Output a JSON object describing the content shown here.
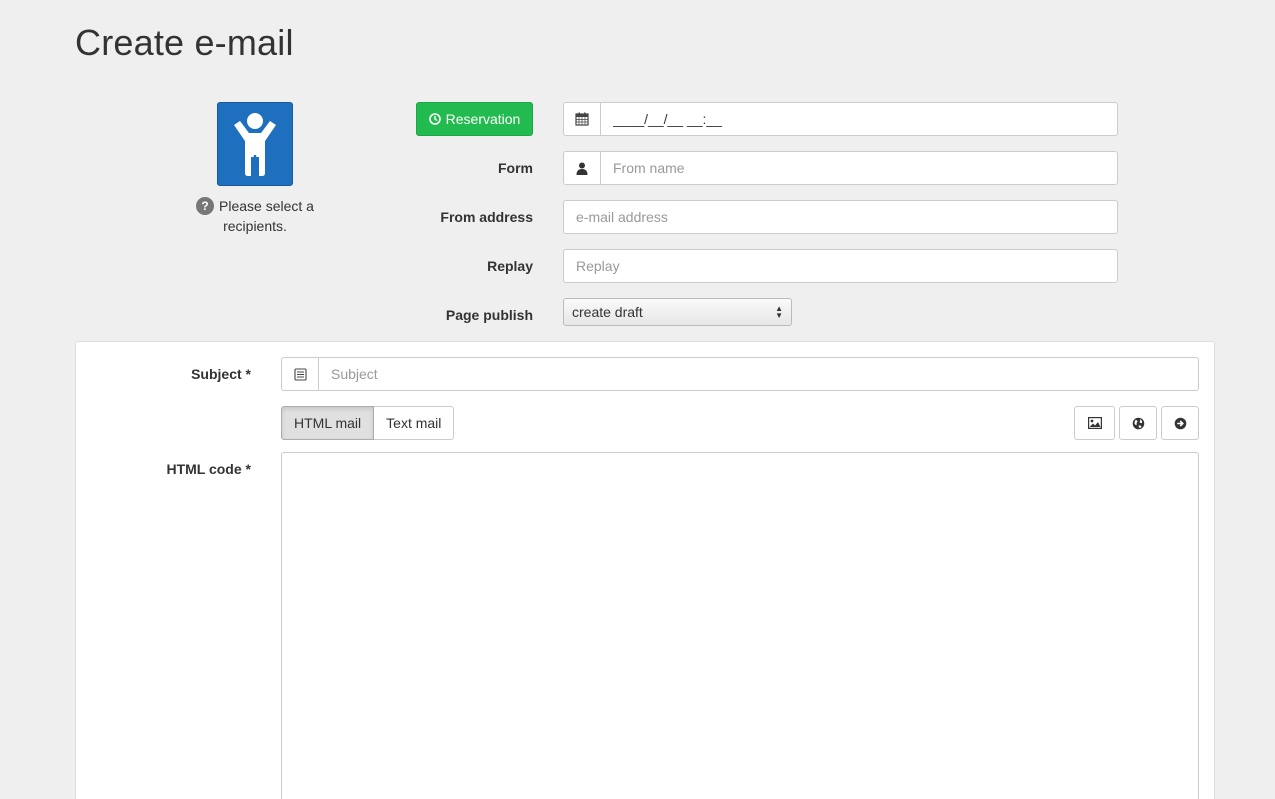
{
  "page": {
    "title": "Create e-mail"
  },
  "recipient": {
    "icon": "person-icon",
    "help_badge": "?",
    "help_text": "Please select a recipients."
  },
  "form": {
    "reservation_button": "Reservation",
    "datetime_value": "____/__/__ __:__",
    "from_label": "Form",
    "from_placeholder": "From name",
    "from_address_label": "From address",
    "from_address_placeholder": "e-mail address",
    "reply_label": "Replay",
    "reply_placeholder": "Replay",
    "publish_label": "Page publish",
    "publish_selected": "create draft"
  },
  "panel": {
    "subject_label": "Subject",
    "subject_required": "*",
    "subject_placeholder": "Subject",
    "tabs": [
      {
        "label": "HTML mail",
        "active": true
      },
      {
        "label": "Text mail",
        "active": false
      }
    ],
    "toolbar_icons": [
      "image-icon",
      "globe-icon",
      "arrow-circle-right-icon"
    ],
    "html_code_label": "HTML code",
    "html_code_required": "*"
  },
  "colors": {
    "accent_green": "#22bb4f",
    "avatar_blue": "#1f6fbf",
    "background": "#efefef"
  }
}
